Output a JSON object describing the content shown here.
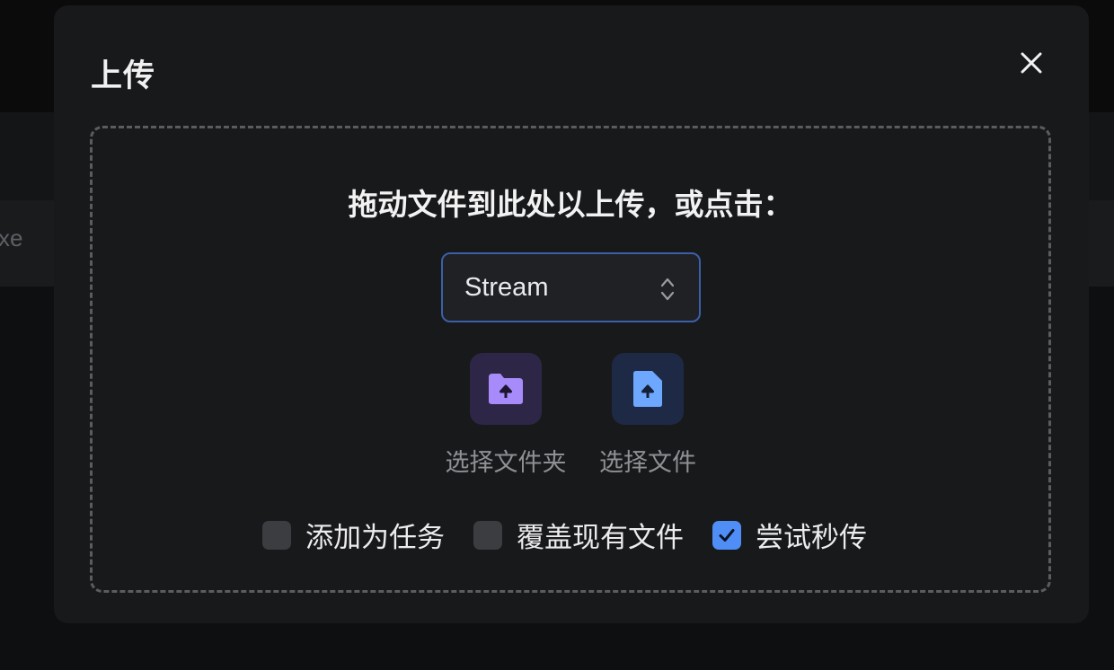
{
  "background": {
    "partial_text": "xe"
  },
  "modal": {
    "title": "上传",
    "close_icon": "close-icon",
    "drop_heading": "拖动文件到此处以上传，或点击：",
    "select": {
      "value": "Stream",
      "icon": "chevron-up-down-icon"
    },
    "actions": [
      {
        "label": "选择文件夹",
        "icon": "folder-upload-icon",
        "color": "#a78bfa",
        "bg": "#2e2647"
      },
      {
        "label": "选择文件",
        "icon": "file-upload-icon",
        "color": "#6ea8fe",
        "bg": "#1e2a45"
      }
    ],
    "options": [
      {
        "label": "添加为任务",
        "checked": false
      },
      {
        "label": "覆盖现有文件",
        "checked": false
      },
      {
        "label": "尝试秒传",
        "checked": true
      }
    ],
    "colors": {
      "accent": "#4f8ef7",
      "select_border": "#3b5fa8"
    }
  }
}
